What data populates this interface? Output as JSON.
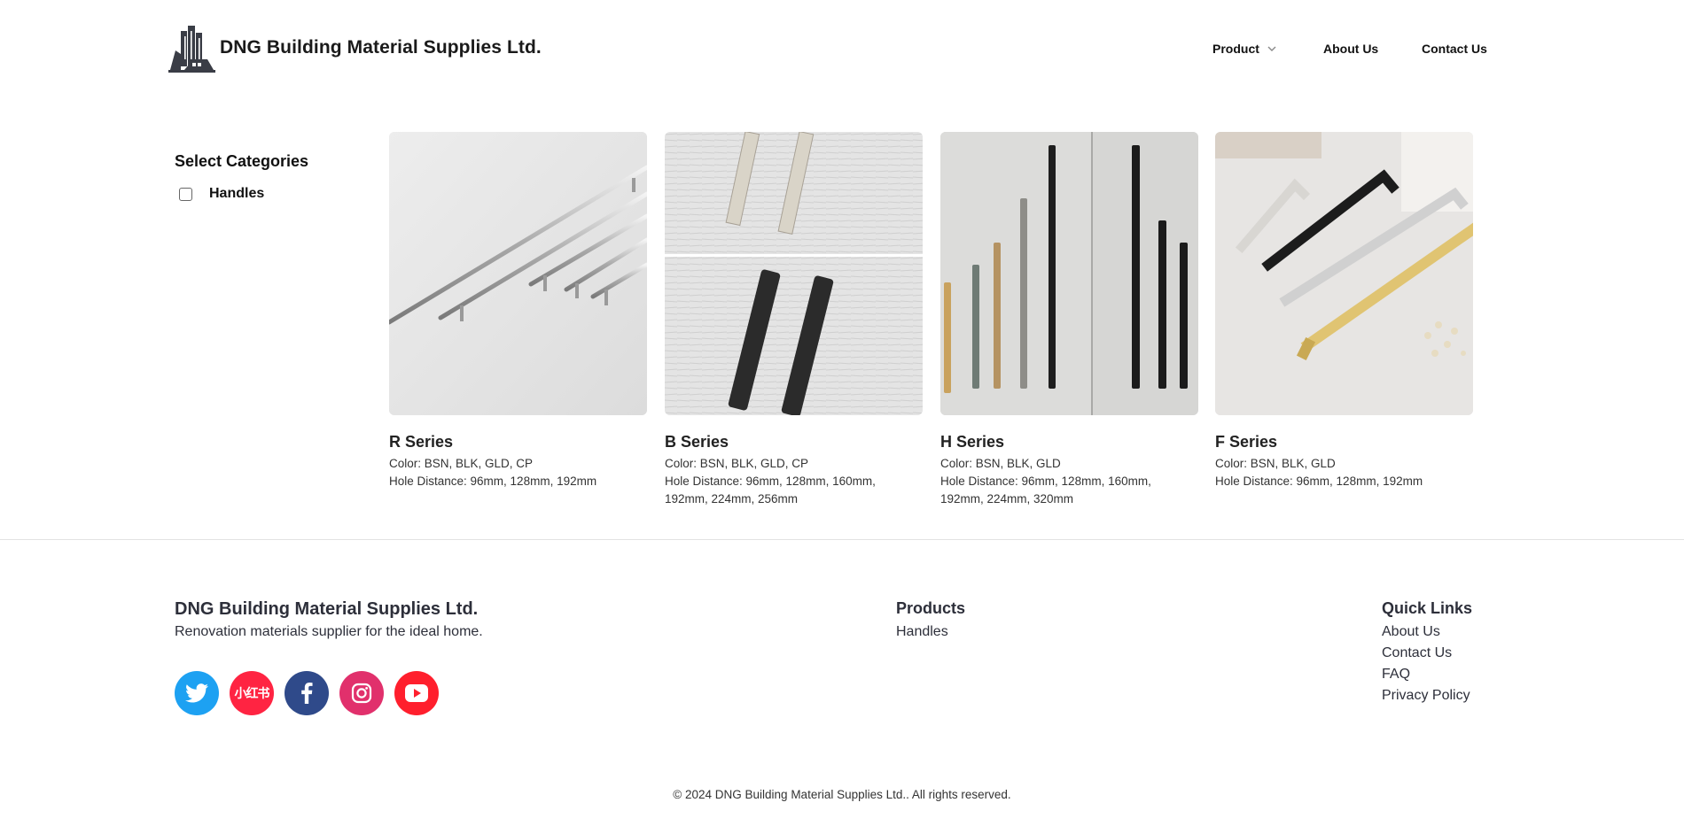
{
  "header": {
    "brand": "DNG Building Material Supplies Ltd.",
    "nav": {
      "product": "Product",
      "about": "About Us",
      "contact": "Contact Us"
    }
  },
  "sidebar": {
    "title": "Select Categories",
    "categories": [
      {
        "label": "Handles",
        "checked": false
      }
    ]
  },
  "products": [
    {
      "name": "R Series",
      "color": "Color: BSN, BLK, GLD, CP",
      "hole_line1": "Hole Distance: 96mm, 128mm, 192mm",
      "hole_line2": ""
    },
    {
      "name": "B Series",
      "color": "Color: BSN, BLK, GLD, CP",
      "hole_line1": "Hole Distance: 96mm, 128mm, 160mm,",
      "hole_line2": "192mm, 224mm, 256mm"
    },
    {
      "name": "H Series",
      "color": "Color: BSN, BLK, GLD",
      "hole_line1": "Hole Distance: 96mm, 128mm, 160mm,",
      "hole_line2": "192mm, 224mm, 320mm"
    },
    {
      "name": "F Series",
      "color": "Color: BSN, BLK, GLD",
      "hole_line1": "Hole Distance: 96mm, 128mm, 192mm",
      "hole_line2": ""
    }
  ],
  "footer": {
    "brand": "DNG Building Material Supplies Ltd.",
    "tagline": "Renovation materials supplier for the ideal home.",
    "socials": {
      "twitter": "twitter-icon",
      "xiaohongshu": "小红书",
      "facebook": "facebook-icon",
      "instagram": "instagram-icon",
      "youtube": "youtube-icon"
    },
    "products_title": "Products",
    "products_links": [
      "Handles"
    ],
    "quick_title": "Quick Links",
    "quick_links": [
      "About Us",
      "Contact Us",
      "FAQ",
      "Privacy Policy"
    ],
    "copyright": "© 2024 DNG Building Material Supplies Ltd.. All rights reserved."
  },
  "colors": {
    "twitter": "#1da1f2",
    "xiaohongshu": "#ff2442",
    "facebook": "#2f4a8a",
    "instagram": "#e1306c",
    "youtube": "#ff1f2d",
    "footer_text": "#2d2f3a"
  }
}
